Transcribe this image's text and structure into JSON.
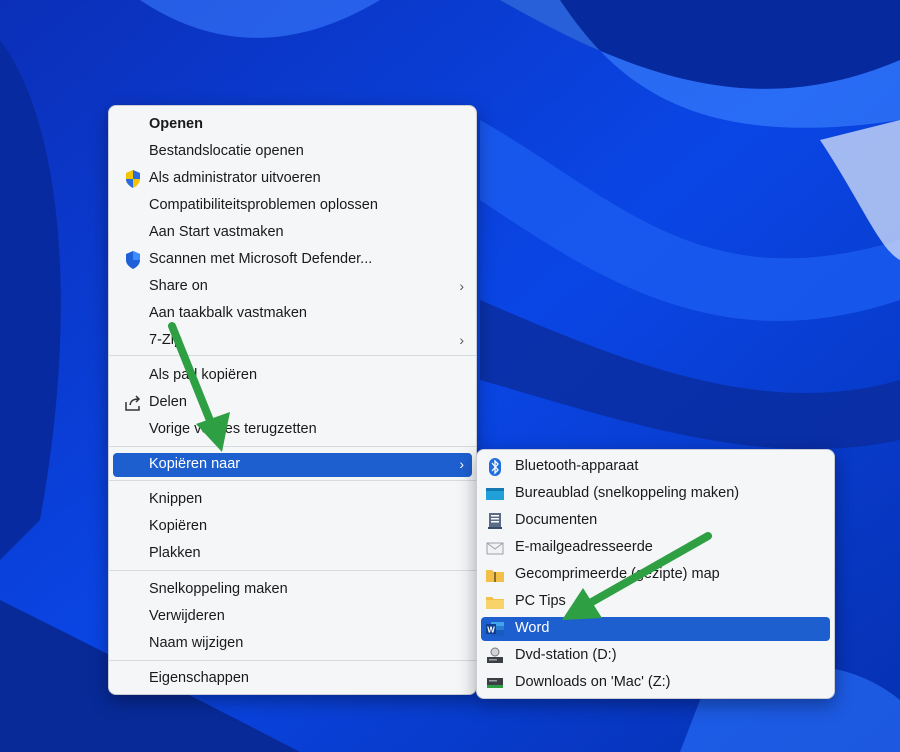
{
  "context_menu": {
    "items": [
      {
        "label": "Openen"
      },
      {
        "label": "Bestandslocatie openen"
      },
      {
        "label": "Als administrator uitvoeren",
        "icon": "uac-shield-icon"
      },
      {
        "label": "Compatibiliteitsproblemen oplossen"
      },
      {
        "label": "Aan Start vastmaken"
      },
      {
        "label": "Scannen met Microsoft Defender...",
        "icon": "defender-shield-icon"
      },
      {
        "label": "Share on"
      },
      {
        "label": "Aan taakbalk vastmaken"
      },
      {
        "label": "7-Zip"
      },
      {
        "label": "Als pad kopiëren"
      },
      {
        "label": "Delen",
        "icon": "share-icon"
      },
      {
        "label": "Vorige versies terugzetten"
      },
      {
        "label": "Kopiëren naar"
      },
      {
        "label": "Knippen"
      },
      {
        "label": "Kopiëren"
      },
      {
        "label": "Plakken"
      },
      {
        "label": "Snelkoppeling maken"
      },
      {
        "label": "Verwijderen"
      },
      {
        "label": "Naam wijzigen"
      },
      {
        "label": "Eigenschappen"
      }
    ]
  },
  "submenu": {
    "items": [
      {
        "label": "Bluetooth-apparaat",
        "icon": "bluetooth-icon"
      },
      {
        "label": "Bureaublad (snelkoppeling maken)",
        "icon": "desktop-icon"
      },
      {
        "label": "Documenten",
        "icon": "documents-icon"
      },
      {
        "label": "E-mailgeadresseerde",
        "icon": "mail-icon"
      },
      {
        "label": "Gecomprimeerde (gezipte) map",
        "icon": "zip-folder-icon"
      },
      {
        "label": "PC Tips",
        "icon": "folder-icon"
      },
      {
        "label": "Word",
        "icon": "word-icon"
      },
      {
        "label": "Dvd-station (D:)",
        "icon": "dvd-drive-icon"
      },
      {
        "label": "Downloads on 'Mac' (Z:)",
        "icon": "network-drive-icon"
      }
    ]
  },
  "colors": {
    "highlight": "#1e5fcf",
    "arrow": "#2ea043",
    "wallpaper": "#0a3fd8"
  }
}
